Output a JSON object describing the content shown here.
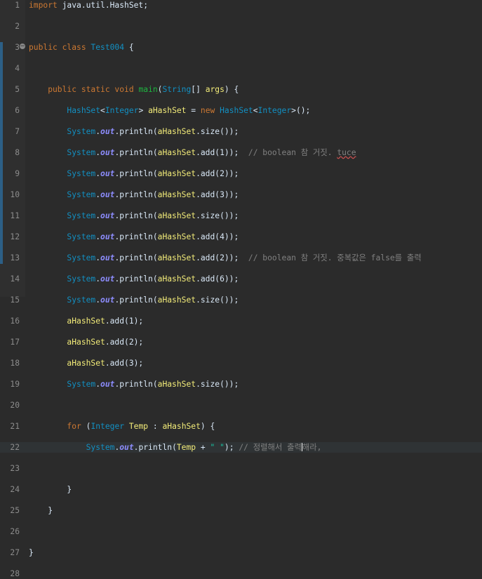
{
  "editor": {
    "fold_glyph": "−",
    "lines": [
      {
        "n": "1",
        "tokens": [
          {
            "t": "import",
            "c": "k"
          },
          {
            "t": " java.util.HashSet;",
            "c": "pn"
          }
        ]
      },
      {
        "n": "2",
        "tokens": []
      },
      {
        "n": "3",
        "tokens": [
          {
            "t": "public class ",
            "c": "k"
          },
          {
            "t": "Test004",
            "c": "ty"
          },
          {
            "t": " {",
            "c": "pn"
          }
        ]
      },
      {
        "n": "4",
        "tokens": []
      },
      {
        "n": "5",
        "fold": true,
        "tokens": [
          {
            "t": "    public static void ",
            "c": "k"
          },
          {
            "t": "main",
            "c": "mth"
          },
          {
            "t": "(",
            "c": "pn"
          },
          {
            "t": "String",
            "c": "ty"
          },
          {
            "t": "[] ",
            "c": "pn"
          },
          {
            "t": "args",
            "c": "vr"
          },
          {
            "t": ") {",
            "c": "pn"
          }
        ]
      },
      {
        "n": "6",
        "tokens": [
          {
            "t": "        HashSet",
            "c": "ty"
          },
          {
            "t": "<",
            "c": "pn"
          },
          {
            "t": "Integer",
            "c": "ty"
          },
          {
            "t": "> ",
            "c": "pn"
          },
          {
            "t": "aHashSet",
            "c": "vr"
          },
          {
            "t": " = ",
            "c": "pn"
          },
          {
            "t": "new ",
            "c": "k"
          },
          {
            "t": "HashSet",
            "c": "ty"
          },
          {
            "t": "<",
            "c": "pn"
          },
          {
            "t": "Integer",
            "c": "ty"
          },
          {
            "t": ">();",
            "c": "pn"
          }
        ]
      },
      {
        "n": "7",
        "tokens": [
          {
            "t": "        System",
            "c": "ty"
          },
          {
            "t": ".",
            "c": "pn"
          },
          {
            "t": "out",
            "c": "fld"
          },
          {
            "t": ".println(",
            "c": "pn"
          },
          {
            "t": "aHashSet",
            "c": "vr"
          },
          {
            "t": ".size());",
            "c": "pn"
          }
        ]
      },
      {
        "n": "8",
        "tokens": [
          {
            "t": "        System",
            "c": "ty"
          },
          {
            "t": ".",
            "c": "pn"
          },
          {
            "t": "out",
            "c": "fld"
          },
          {
            "t": ".println(",
            "c": "pn"
          },
          {
            "t": "aHashSet",
            "c": "vr"
          },
          {
            "t": ".add(1));  ",
            "c": "pn"
          },
          {
            "t": "// boolean 참 거짓. ",
            "c": "cm"
          },
          {
            "t": "tuce",
            "c": "cm squig"
          }
        ]
      },
      {
        "n": "9",
        "tokens": [
          {
            "t": "        System",
            "c": "ty"
          },
          {
            "t": ".",
            "c": "pn"
          },
          {
            "t": "out",
            "c": "fld"
          },
          {
            "t": ".println(",
            "c": "pn"
          },
          {
            "t": "aHashSet",
            "c": "vr"
          },
          {
            "t": ".add(2));",
            "c": "pn"
          }
        ]
      },
      {
        "n": "10",
        "tokens": [
          {
            "t": "        System",
            "c": "ty"
          },
          {
            "t": ".",
            "c": "pn"
          },
          {
            "t": "out",
            "c": "fld"
          },
          {
            "t": ".println(",
            "c": "pn"
          },
          {
            "t": "aHashSet",
            "c": "vr"
          },
          {
            "t": ".add(3));",
            "c": "pn"
          }
        ]
      },
      {
        "n": "11",
        "tokens": [
          {
            "t": "        System",
            "c": "ty"
          },
          {
            "t": ".",
            "c": "pn"
          },
          {
            "t": "out",
            "c": "fld"
          },
          {
            "t": ".println(",
            "c": "pn"
          },
          {
            "t": "aHashSet",
            "c": "vr"
          },
          {
            "t": ".size());",
            "c": "pn"
          }
        ]
      },
      {
        "n": "12",
        "tokens": [
          {
            "t": "        System",
            "c": "ty"
          },
          {
            "t": ".",
            "c": "pn"
          },
          {
            "t": "out",
            "c": "fld"
          },
          {
            "t": ".println(",
            "c": "pn"
          },
          {
            "t": "aHashSet",
            "c": "vr"
          },
          {
            "t": ".add(4));",
            "c": "pn"
          }
        ]
      },
      {
        "n": "13",
        "tokens": [
          {
            "t": "        System",
            "c": "ty"
          },
          {
            "t": ".",
            "c": "pn"
          },
          {
            "t": "out",
            "c": "fld"
          },
          {
            "t": ".println(",
            "c": "pn"
          },
          {
            "t": "aHashSet",
            "c": "vr"
          },
          {
            "t": ".add(2));  ",
            "c": "pn"
          },
          {
            "t": "// boolean 참 거짓. 중복값은 false를 출력",
            "c": "cm"
          }
        ]
      },
      {
        "n": "14",
        "tokens": [
          {
            "t": "        System",
            "c": "ty"
          },
          {
            "t": ".",
            "c": "pn"
          },
          {
            "t": "out",
            "c": "fld"
          },
          {
            "t": ".println(",
            "c": "pn"
          },
          {
            "t": "aHashSet",
            "c": "vr"
          },
          {
            "t": ".add(6));",
            "c": "pn"
          }
        ]
      },
      {
        "n": "15",
        "tokens": [
          {
            "t": "        System",
            "c": "ty"
          },
          {
            "t": ".",
            "c": "pn"
          },
          {
            "t": "out",
            "c": "fld"
          },
          {
            "t": ".println(",
            "c": "pn"
          },
          {
            "t": "aHashSet",
            "c": "vr"
          },
          {
            "t": ".size());",
            "c": "pn"
          }
        ]
      },
      {
        "n": "16",
        "tokens": [
          {
            "t": "        aHashSet",
            "c": "vr"
          },
          {
            "t": ".add(1);",
            "c": "pn"
          }
        ]
      },
      {
        "n": "17",
        "tokens": [
          {
            "t": "        aHashSet",
            "c": "vr"
          },
          {
            "t": ".add(2);",
            "c": "pn"
          }
        ]
      },
      {
        "n": "18",
        "tokens": [
          {
            "t": "        aHashSet",
            "c": "vr"
          },
          {
            "t": ".add(3);",
            "c": "pn"
          }
        ]
      },
      {
        "n": "19",
        "tokens": [
          {
            "t": "        System",
            "c": "ty"
          },
          {
            "t": ".",
            "c": "pn"
          },
          {
            "t": "out",
            "c": "fld"
          },
          {
            "t": ".println(",
            "c": "pn"
          },
          {
            "t": "aHashSet",
            "c": "vr"
          },
          {
            "t": ".size());",
            "c": "pn"
          }
        ]
      },
      {
        "n": "20",
        "tokens": []
      },
      {
        "n": "21",
        "tokens": [
          {
            "t": "        for ",
            "c": "k"
          },
          {
            "t": "(",
            "c": "pn"
          },
          {
            "t": "Integer ",
            "c": "ty"
          },
          {
            "t": "Temp",
            "c": "vr"
          },
          {
            "t": " : ",
            "c": "pn"
          },
          {
            "t": "aHashSet",
            "c": "vr"
          },
          {
            "t": ") {",
            "c": "pn"
          }
        ]
      },
      {
        "n": "22",
        "current": true,
        "tokens": [
          {
            "t": "            System",
            "c": "ty"
          },
          {
            "t": ".",
            "c": "pn"
          },
          {
            "t": "out",
            "c": "fld"
          },
          {
            "t": ".println(",
            "c": "pn"
          },
          {
            "t": "Temp",
            "c": "vr"
          },
          {
            "t": " + ",
            "c": "pn"
          },
          {
            "t": "\" \"",
            "c": "str"
          },
          {
            "t": "); ",
            "c": "pn"
          },
          {
            "t": "// 정렬해서 출력",
            "c": "cm"
          },
          {
            "caret": true
          },
          {
            "t": "해라,",
            "c": "cm"
          }
        ]
      },
      {
        "n": "23",
        "tokens": []
      },
      {
        "n": "24",
        "tokens": [
          {
            "t": "        }",
            "c": "pn"
          }
        ]
      },
      {
        "n": "25",
        "tokens": [
          {
            "t": "    }",
            "c": "pn"
          }
        ]
      },
      {
        "n": "26",
        "tokens": []
      },
      {
        "n": "27",
        "tokens": [
          {
            "t": "}",
            "c": "pn"
          }
        ]
      },
      {
        "n": "28",
        "tokens": []
      }
    ]
  }
}
